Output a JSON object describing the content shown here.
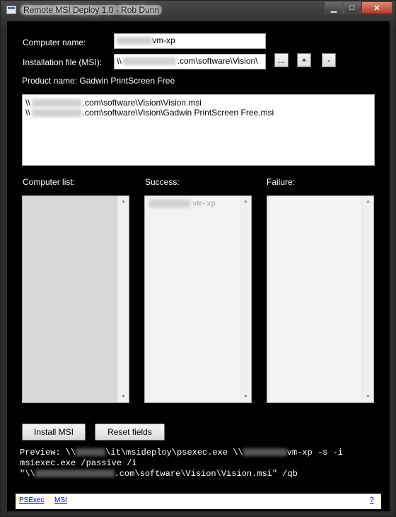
{
  "window": {
    "title": "Remote MSI Deploy 1.0 - Rob Dunn"
  },
  "form": {
    "computer_name_label": "Computer name:",
    "computer_name_value": "vm-xp",
    "install_file_label": "Installation file (MSI):",
    "install_file_prefix": "\\\\",
    "install_file_value": ".com\\software\\Vision\\",
    "browse_label": "...",
    "add_label": "+",
    "remove_label": "-",
    "product_name_label": "Product name:",
    "product_name_value": "Gadwin PrintScreen Free"
  },
  "msi_list": [
    {
      "prefix": "\\\\",
      "suffix": ".com\\software\\Vision\\Vision.msi"
    },
    {
      "prefix": "\\\\",
      "suffix": ".com\\software\\Vision\\Gadwin PrintScreen Free.msi"
    }
  ],
  "lists": {
    "computer_label": "Computer list:",
    "success_label": "Success:",
    "failure_label": "Failure:",
    "success_items": [
      "vm-xp"
    ]
  },
  "buttons": {
    "install": "Install MSI",
    "reset": "Reset fields"
  },
  "preview": {
    "line1_a": "Preview: \\\\",
    "line1_b": "\\it\\msideploy\\psexec.exe \\\\",
    "line1_c": "vm-xp -s -i",
    "line2": "msiexec.exe /passive /i",
    "line3_a": "\"\\\\",
    "line3_b": ".com\\software\\Vision\\Vision.msi\" /qb"
  },
  "links": {
    "psexec": "PSExec",
    "msi": "MSI",
    "help": "?"
  }
}
